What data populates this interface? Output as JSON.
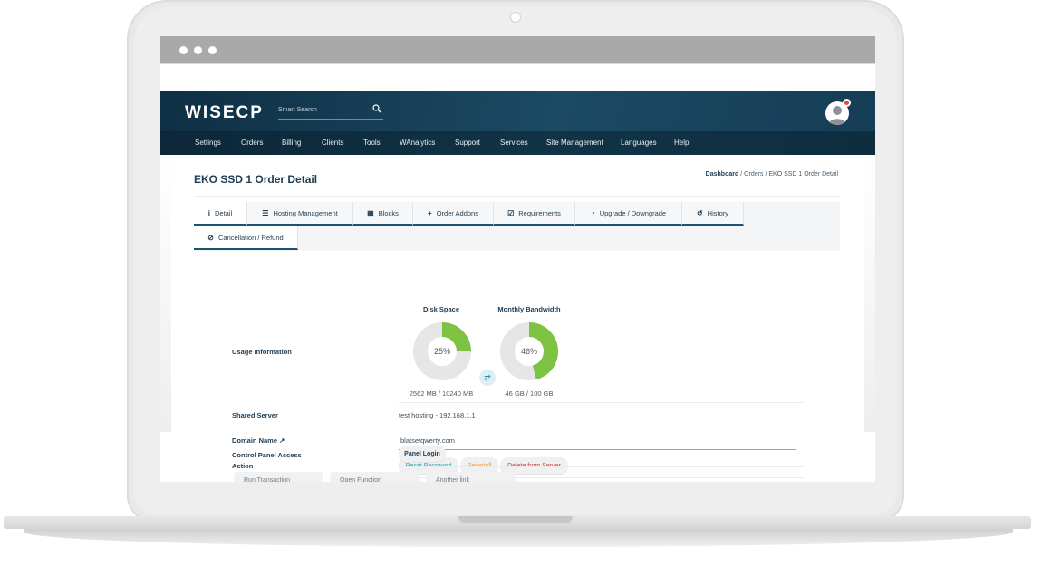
{
  "app": {
    "brand": "WISECP",
    "search_placeholder": "Smart Search"
  },
  "nav": {
    "items": [
      "Settings",
      "Orders",
      "Billing",
      "Clients",
      "Tools",
      "WAnalytics",
      "Support",
      "Services",
      "Site Management",
      "Languages",
      "Help"
    ]
  },
  "page": {
    "title": "EKO SSD 1 Order Detail"
  },
  "breadcrumb": {
    "home": "Dashboard",
    "sep": "/",
    "section": "Orders",
    "current": "EKO SSD 1 Order Detail"
  },
  "tabs": [
    {
      "label": "Detail",
      "icon": "info-icon"
    },
    {
      "label": "Hosting Management",
      "icon": "list-icon"
    },
    {
      "label": "Blocks",
      "icon": "grid-icon"
    },
    {
      "label": "Order Addons",
      "icon": "plus-icon"
    },
    {
      "label": "Requirements",
      "icon": "checkbox-icon"
    },
    {
      "label": "Upgrade / Downgrade",
      "icon": "gauge-icon"
    },
    {
      "label": "History",
      "icon": "history-icon"
    },
    {
      "label": "Cancellation / Refund",
      "icon": "ban-icon"
    }
  ],
  "usage": {
    "label": "Usage Information",
    "disk": {
      "title": "Disk Space",
      "percent_text": "25%",
      "percent": 25,
      "caption": "2562 MB / 10240 MB"
    },
    "bandwidth": {
      "title": "Monthly Bandwidth",
      "percent_text": "46%",
      "percent": 46,
      "caption": "46 GB / 100 GB"
    }
  },
  "shared_server": {
    "label": "Shared Server",
    "value": "test hosting - 192.168.1.1"
  },
  "domain": {
    "label": "Domain Name",
    "value": "blatsetqwerty.com"
  },
  "action": {
    "label": "Action",
    "reset": "Reset Password",
    "reinstall": "Reinstall",
    "delete": "Delete from Server"
  },
  "control_panel": {
    "label": "Control Panel Access",
    "login": "Panel Login"
  },
  "sub_tabs": [
    "Run Transaction",
    "Open Function",
    "Another link"
  ],
  "colors": {
    "header": "#163e56",
    "accent_green": "#7dc242",
    "donut_track": "#e6e6e6",
    "title": "#1d3c53"
  }
}
